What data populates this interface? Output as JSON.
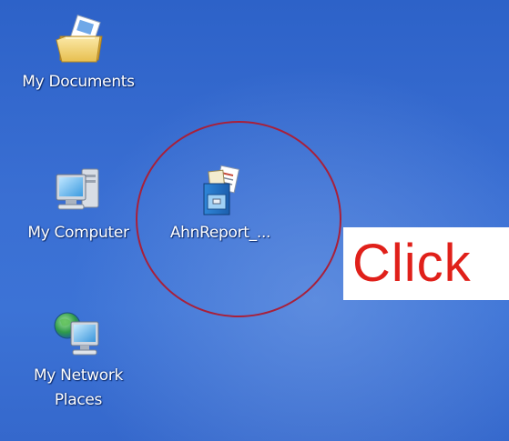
{
  "desktop": {
    "icons": [
      {
        "label": "My Documents",
        "icon": "my-documents-folder-icon"
      },
      {
        "label": "My Computer",
        "icon": "my-computer-icon"
      },
      {
        "label": "AhnReport_...",
        "icon": "ahnreport-app-icon"
      },
      {
        "label": "My Network Places",
        "label_lines": [
          "My Network",
          "Places"
        ],
        "icon": "network-places-icon"
      }
    ]
  },
  "annotation": {
    "callout_text": "Click",
    "circle_color": "#a8203a",
    "callout_text_color": "#e0201a"
  },
  "colors": {
    "desktop_blue": "#3a6fd3"
  }
}
